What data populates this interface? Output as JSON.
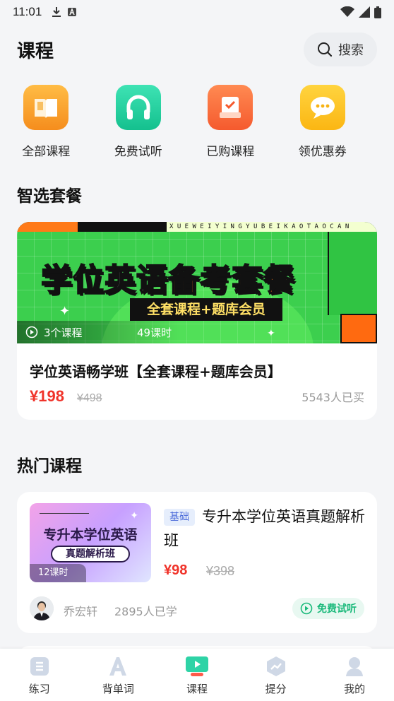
{
  "status_bar": {
    "time": "11:01"
  },
  "header": {
    "title": "课程",
    "search_label": "搜索"
  },
  "quick_nav": [
    {
      "label": "全部课程",
      "icon": "book-icon",
      "color": "#f8a12c"
    },
    {
      "label": "免费试听",
      "icon": "headphones-icon",
      "color": "#1fcf9c"
    },
    {
      "label": "已购课程",
      "icon": "purchased-box-icon",
      "color": "#ff6a3d"
    },
    {
      "label": "领优惠券",
      "icon": "chat-coupon-icon",
      "color": "#ffc520"
    }
  ],
  "package_section": {
    "title": "智选套餐",
    "banner": {
      "letters": "XUEWEIYINGYUBEIKAOTAOCAN",
      "title_white": "学位英语",
      "title_orange": "备考套餐",
      "subtitle": "全套课程+题库会员",
      "course_count": "3个课程",
      "hours": "49课时"
    },
    "name": "学位英语畅学班【全套课程+题库会员】",
    "price": "¥198",
    "original_price": "¥498",
    "buyers": "5543人已买"
  },
  "hot_section": {
    "title": "热门课程",
    "courses": [
      {
        "thumb_title": "专升本学位英语",
        "thumb_subtitle": "真题解析班",
        "thumb_hours": "12课时",
        "tag": "基础",
        "title": "专升本学位英语真题解析班",
        "price": "¥98",
        "original_price": "¥398",
        "teacher": "乔宏轩",
        "learners": "2895人已学",
        "free_trial": "免费试听"
      }
    ]
  },
  "tab_bar": [
    {
      "label": "练习",
      "icon": "practice-icon",
      "active": false
    },
    {
      "label": "背单词",
      "icon": "vocabulary-icon",
      "active": false
    },
    {
      "label": "课程",
      "icon": "course-play-icon",
      "active": true
    },
    {
      "label": "提分",
      "icon": "score-boost-icon",
      "active": false
    },
    {
      "label": "我的",
      "icon": "profile-icon",
      "active": false
    }
  ],
  "colors": {
    "accent_green": "#19b97a",
    "price_red": "#f0332a",
    "tab_inactive": "#cfd8e6"
  }
}
